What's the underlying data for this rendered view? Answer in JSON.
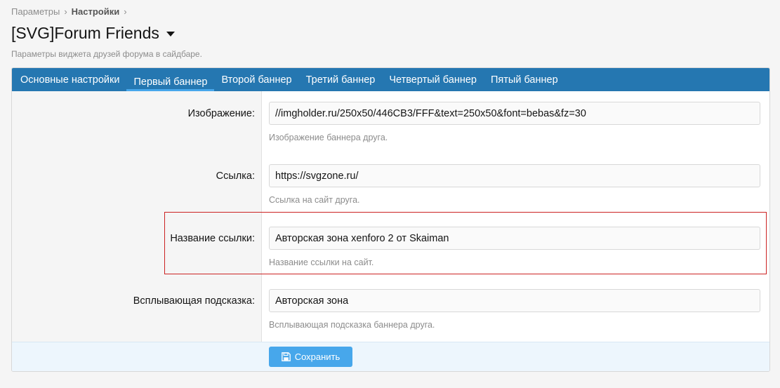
{
  "breadcrumb": {
    "item1": "Параметры",
    "item2": "Настройки"
  },
  "page": {
    "title": "[SVG]Forum Friends",
    "description": "Параметры виджета друзей форума в сайдбаре."
  },
  "tabs": [
    {
      "label": "Основные настройки"
    },
    {
      "label": "Первый баннер"
    },
    {
      "label": "Второй баннер"
    },
    {
      "label": "Третий баннер"
    },
    {
      "label": "Четвертый баннер"
    },
    {
      "label": "Пятый баннер"
    }
  ],
  "fields": {
    "image": {
      "label": "Изображение:",
      "value": "//imgholder.ru/250x50/446CB3/FFF&text=250x50&font=bebas&fz=30",
      "hint": "Изображение баннера друга."
    },
    "link": {
      "label": "Ссылка:",
      "value": "https://svgzone.ru/",
      "hint": "Ссылка на сайт друга."
    },
    "link_name": {
      "label": "Название ссылки:",
      "value": "Авторская зона xenforo 2 от Skaiman",
      "hint": "Название ссылки на сайт."
    },
    "tooltip": {
      "label": "Всплывающая подсказка:",
      "value": "Авторская зона",
      "hint": "Всплывающая подсказка баннера друга."
    }
  },
  "actions": {
    "save_label": "Сохранить"
  },
  "colors": {
    "accent": "#2577b1",
    "button": "#47a7eb",
    "highlight": "#cc2222"
  }
}
